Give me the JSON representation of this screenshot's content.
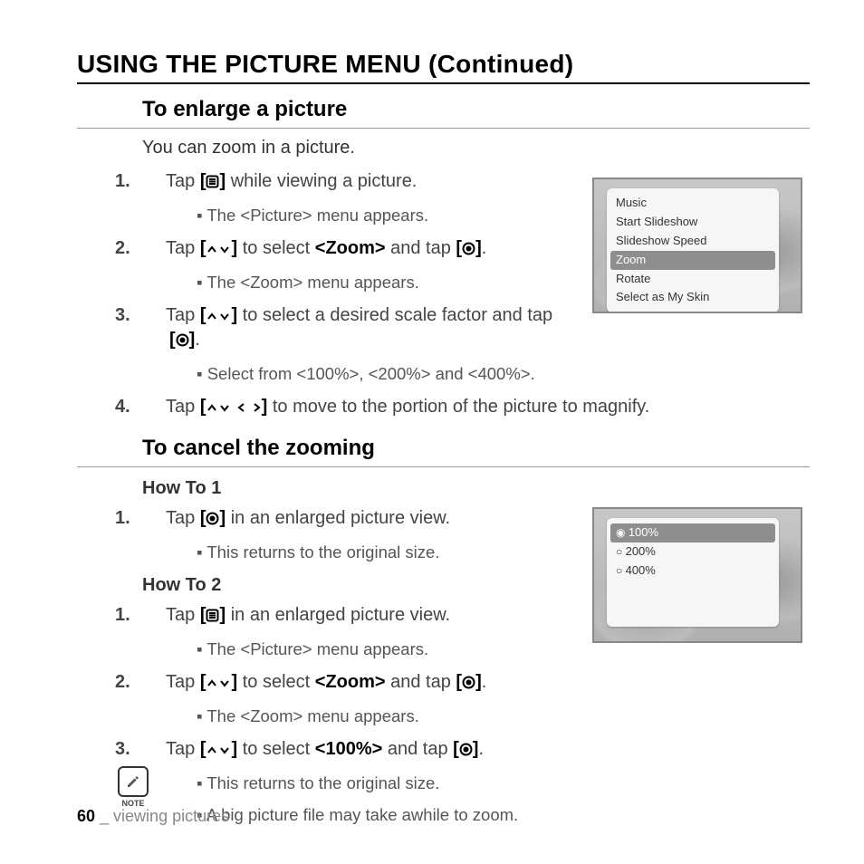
{
  "page_title": "USING THE PICTURE MENU (Continued)",
  "section_enlarge": {
    "heading": "To enlarge a picture",
    "intro": "You can zoom in a picture.",
    "steps": [
      {
        "n": "1.",
        "pre": "Tap ",
        "icon": "menu",
        "post": " while viewing a picture.",
        "sub": "The <Picture> menu appears."
      },
      {
        "n": "2.",
        "pre": "Tap ",
        "icon": "updown",
        "mid1": " to select ",
        "bold1": "<Zoom>",
        "mid2": " and tap ",
        "icon2": "dot",
        "post": ".",
        "sub": "The <Zoom> menu appears."
      },
      {
        "n": "3.",
        "pre": "Tap ",
        "icon": "updown",
        "mid1": " to select a desired scale factor and tap ",
        "icon2": "dot",
        "post": ".",
        "sub": "Select from <100%>, <200%> and <400%>."
      },
      {
        "n": "4.",
        "pre": "Tap ",
        "icon": "udlr",
        "post": " to move to the portion of the picture to magnify."
      }
    ]
  },
  "section_cancel": {
    "heading": "To cancel the zooming",
    "howto1_label": "How To 1",
    "howto1": [
      {
        "n": "1.",
        "pre": "Tap ",
        "icon": "dot",
        "post": " in an enlarged picture view.",
        "sub": "This returns to the original size."
      }
    ],
    "howto2_label": "How To 2",
    "howto2": [
      {
        "n": "1.",
        "pre": "Tap ",
        "icon": "menu",
        "post": " in an enlarged picture view.",
        "sub": "The <Picture> menu appears."
      },
      {
        "n": "2.",
        "pre": "Tap ",
        "icon": "updown",
        "mid1": " to select ",
        "bold1": "<Zoom>",
        "mid2": " and tap ",
        "icon2": "dot",
        "post": ".",
        "sub": "The <Zoom> menu appears."
      },
      {
        "n": "3.",
        "pre": "Tap ",
        "icon": "updown",
        "mid1": " to select ",
        "bold1": "<100%>",
        "mid2": " and tap ",
        "icon2": "dot",
        "post": ".",
        "sub": "This returns to the original size."
      }
    ],
    "note": "A big picture file may take awhile to zoom.",
    "note_label": "NOTE"
  },
  "device_menu1": {
    "items": [
      "Music",
      "Start Slideshow",
      "Slideshow Speed",
      "Zoom",
      "Rotate",
      "Select as My Skin"
    ],
    "selected_index": 3
  },
  "device_menu2": {
    "items": [
      "100%",
      "200%",
      "400%"
    ],
    "selected_index": 0
  },
  "footer": {
    "page": "60",
    "sep": " _ ",
    "chapter": "viewing pictures"
  }
}
